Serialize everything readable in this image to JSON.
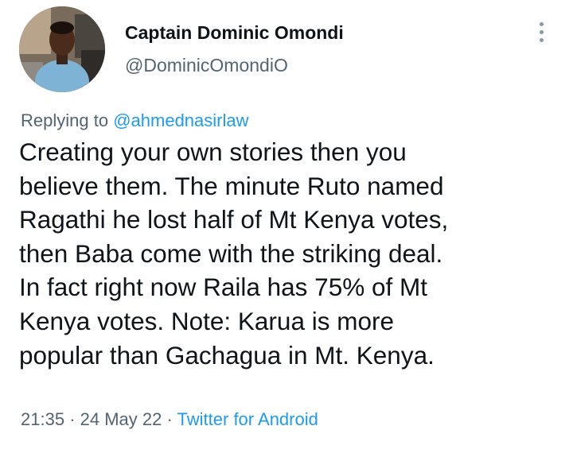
{
  "tweet": {
    "author": {
      "name": "Captain Dominic Omondi",
      "handle": "@DominicOmondiO"
    },
    "reply": {
      "prefix": "Replying to",
      "target": "@ahmednasirlaw"
    },
    "lines": [
      "Creating your own stories then you",
      "believe them. The minute Ruto named",
      "Ragathi he lost half of Mt Kenya votes,",
      "then Baba come with the striking deal.",
      "In fact right now Raila has 75% of Mt",
      "Kenya votes. Note: Karua is more",
      "popular than Gachagua in Mt. Kenya."
    ],
    "meta": {
      "time": "21:35",
      "sep": "·",
      "date": "24 May 22",
      "source": "Twitter for Android"
    }
  },
  "icons": {
    "more": "more-vertical-icon",
    "avatar": "profile-photo"
  },
  "colors": {
    "text": "#0f1419",
    "muted": "#536471",
    "link": "#1d9bf0"
  }
}
